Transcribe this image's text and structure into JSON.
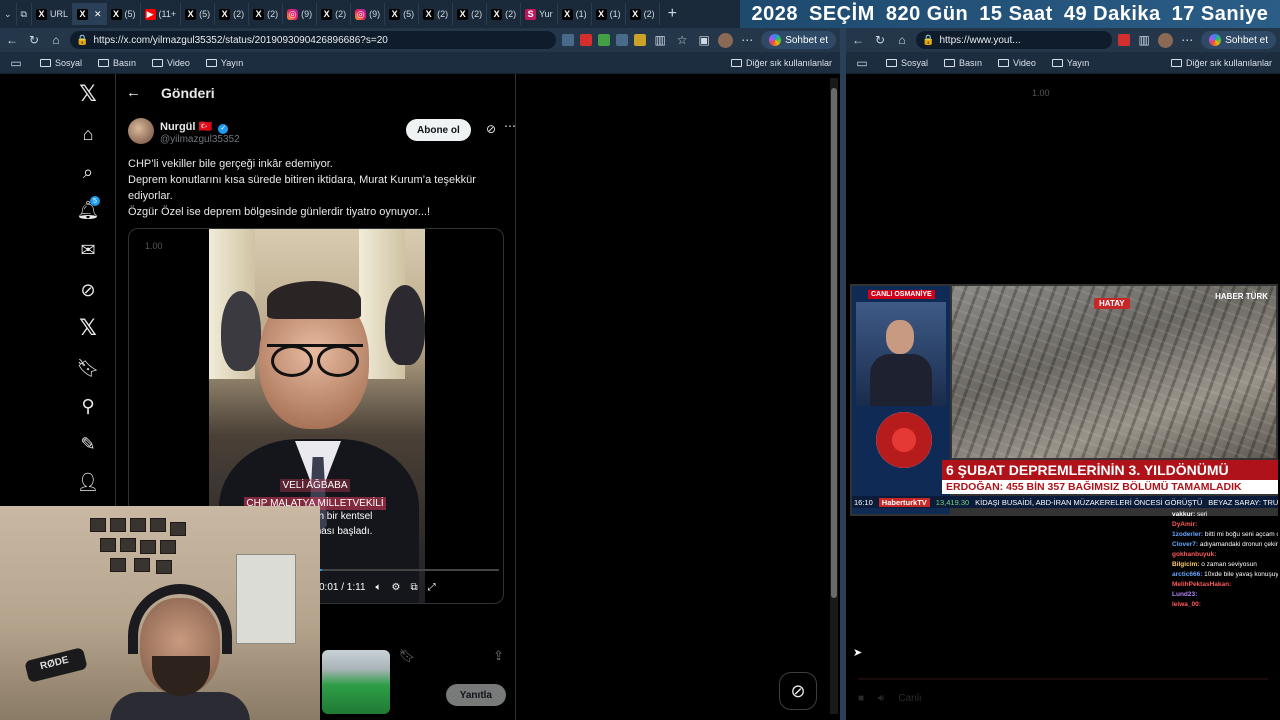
{
  "tabs": [
    {
      "icon": "X",
      "label": "URL",
      "kind": "x"
    },
    {
      "icon": "X",
      "label": "",
      "kind": "x",
      "active": true
    },
    {
      "icon": "X",
      "label": "(5)",
      "kind": "x"
    },
    {
      "icon": "▶",
      "label": "(11+",
      "kind": "yt"
    },
    {
      "icon": "X",
      "label": "(5)",
      "kind": "x"
    },
    {
      "icon": "X",
      "label": "(2)",
      "kind": "x"
    },
    {
      "icon": "X",
      "label": "(2)",
      "kind": "x"
    },
    {
      "icon": "◎",
      "label": "(9)",
      "kind": "ig"
    },
    {
      "icon": "X",
      "label": "(2)",
      "kind": "x"
    },
    {
      "icon": "◎",
      "label": "(9)",
      "kind": "ig"
    },
    {
      "icon": "X",
      "label": "(5)",
      "kind": "x"
    },
    {
      "icon": "X",
      "label": "(2)",
      "kind": "x"
    },
    {
      "icon": "X",
      "label": "(2)",
      "kind": "x"
    },
    {
      "icon": "X",
      "label": "(2)",
      "kind": "x"
    },
    {
      "icon": "S",
      "label": "Yur",
      "kind": "red"
    },
    {
      "icon": "X",
      "label": "(1)",
      "kind": "x"
    },
    {
      "icon": "X",
      "label": "(1)",
      "kind": "x"
    },
    {
      "icon": "X",
      "label": "(2)",
      "kind": "x"
    }
  ],
  "new_tab": "+",
  "countdown": {
    "year": "2028",
    "label": "SEÇİM",
    "days": "820 Gün",
    "hours": "15 Saat",
    "minutes": "49 Dakika",
    "seconds": "17 Saniye"
  },
  "left_browser": {
    "url": "https://x.com/yilmazgul35352/status/2019093090426896686?s=20",
    "copilot_label": "Sohbet et",
    "bookmarks": [
      "Sosyal",
      "Basın",
      "Video",
      "Yayın"
    ],
    "other_bookmarks": "Diğer sık kullanılanlar"
  },
  "right_browser": {
    "url": "https://www.yout...",
    "copilot_label": "Sohbet et",
    "bookmarks": [
      "Sosyal",
      "Basın",
      "Video",
      "Yayın"
    ],
    "other_bookmarks": "Diğer sık kullanılanlar"
  },
  "x": {
    "header_title": "Gönderi",
    "notification_count": "5",
    "author_name": "Nurgül",
    "author_flag": "🇹🇷",
    "author_handle": "@yilmazgul35352",
    "follow_label": "Abone ol",
    "tweet_lines": [
      "CHP’li vekiller bile gerçeği inkâr edemiyor.",
      "Deprem konutlarını kısa sürede bitiren iktidara, Murat Kurum’a teşekkür ediyorlar.",
      "Özgür Özel ise deprem bölgesinde günlerdir tiyatro oynuyor...!"
    ],
    "video_speed": "1.00",
    "video_caption_name": "VELİ AĞBABA",
    "video_caption_title": "CHP MALATYA MİLLETVEKİLİ",
    "video_subtitle_1": "...gün bir kentsel",
    "video_subtitle_2": "...aması başladı.",
    "video_time": "0:01 / 1:11",
    "video_progress": 0.014,
    "reply_label": "Yanıtla"
  },
  "webcam": {
    "mic_brand": "RØDE"
  },
  "youtube": {
    "speed": "1.00",
    "live_label": "CANLI OSMANİYE",
    "location": "HATAY",
    "channel": "HABER TÜRK",
    "headline": "6 ŞUBAT DEPREMLERİNİN 3. YILDÖNÜMÜ",
    "subheadline": "ERDOĞAN: 455 BİN 357 BAĞIMSIZ BÖLÜMÜ TAMAMLADIK",
    "ticker_time": "16:10",
    "ticker_brand": "HaberturkTV",
    "ticker_index": "13,419.30",
    "ticker_text": "KİDAŞI BUSAİDİ, ABD-İRAN MÜZAKERELERİ ÖNCESİ GÖRÜŞTÜ",
    "ticker_text_2": "BEYAZ SARAY: TRUMP İ",
    "chat": [
      {
        "user": "vakkur:",
        "text": "seri",
        "color": "#ffffff"
      },
      {
        "user": "DyAmir:",
        "text": "",
        "color": "#ff5a5a"
      },
      {
        "user": "1zoderler:",
        "text": "bitti mi boğu seni açcam ona göre",
        "color": "#6aa7ff"
      },
      {
        "user": "Clover7:",
        "text": "adıyamandaki dronun çekim yaptığı yer",
        "color": "#6aa7ff"
      },
      {
        "user": "gokhanbuyuk:",
        "text": "",
        "color": "#ff5a5a"
      },
      {
        "user": "Bilgicim:",
        "text": "o zaman seviyosun",
        "color": "#ffcc66"
      },
      {
        "user": "arctic666:",
        "text": "10xde bile yavaş konuşuyor",
        "color": "#6aa7ff"
      },
      {
        "user": "MelihPektasHakan:",
        "text": "",
        "color": "#ff5a5a"
      },
      {
        "user": "Lund23:",
        "text": "",
        "color": "#b388ff"
      },
      {
        "user": "leiwa_00:",
        "text": "",
        "color": "#ff5a5a"
      }
    ],
    "controls_label": "Canlı"
  }
}
